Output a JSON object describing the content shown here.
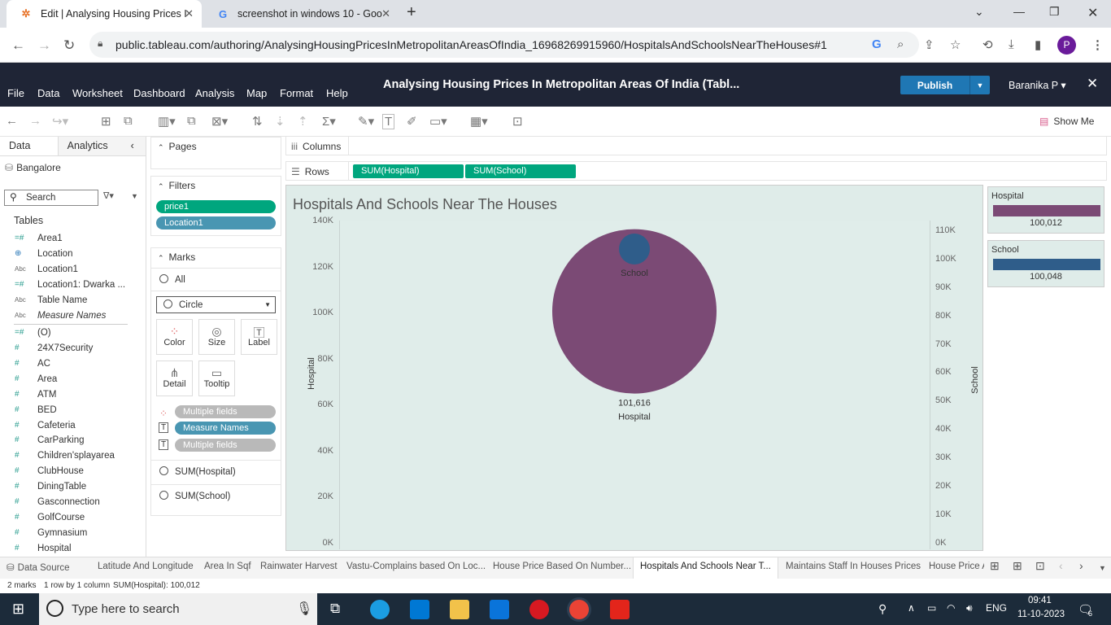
{
  "browser": {
    "tabs": [
      {
        "title": "Edit | Analysing Housing Prices I",
        "favicon": "tableau-icon",
        "active": true
      },
      {
        "title": "screenshot in windows 10 - Goo",
        "favicon": "google-icon",
        "active": false
      }
    ],
    "url": "public.tableau.com/authoring/AnalysingHousingPricesInMetropolitanAreasOfIndia_16968269915960/HospitalsAndSchoolsNearTheHouses#1",
    "profile_initial": "P"
  },
  "tableau": {
    "menu": [
      "File",
      "Data",
      "Worksheet",
      "Dashboard",
      "Analysis",
      "Map",
      "Format",
      "Help"
    ],
    "workbook_title": "Analysing Housing Prices In Metropolitan Areas Of India (Tabl...",
    "publish_label": "Publish",
    "user_name": "Baranika P ▾",
    "show_me": "Show Me"
  },
  "data_pane": {
    "tab_data": "Data",
    "tab_analytics": "Analytics",
    "datasource": "Bangalore",
    "search_placeholder": "Search",
    "tables_heading": "Tables",
    "fields": [
      {
        "name": "Area1",
        "type": "#="
      },
      {
        "name": "Location",
        "type": "globe"
      },
      {
        "name": "Location1",
        "type": "Abc"
      },
      {
        "name": "Location1: Dwarka ...",
        "type": "#="
      },
      {
        "name": "Table Name",
        "type": "Abc"
      },
      {
        "name": "Measure Names",
        "type": "Abc"
      },
      {
        "name": "(O)",
        "type": "#="
      },
      {
        "name": "24X7Security",
        "type": "#"
      },
      {
        "name": "AC",
        "type": "#"
      },
      {
        "name": "Area",
        "type": "#"
      },
      {
        "name": "ATM",
        "type": "#"
      },
      {
        "name": "BED",
        "type": "#"
      },
      {
        "name": "Cafeteria",
        "type": "#"
      },
      {
        "name": "CarParking",
        "type": "#"
      },
      {
        "name": "Children'splayarea",
        "type": "#"
      },
      {
        "name": "ClubHouse",
        "type": "#"
      },
      {
        "name": "DiningTable",
        "type": "#"
      },
      {
        "name": "Gasconnection",
        "type": "#"
      },
      {
        "name": "GolfCourse",
        "type": "#"
      },
      {
        "name": "Gymnasium",
        "type": "#"
      },
      {
        "name": "Hospital",
        "type": "#"
      }
    ]
  },
  "cards": {
    "pages_label": "Pages",
    "filters_label": "Filters",
    "filters": [
      "price1",
      "Location1"
    ],
    "marks_label": "Marks",
    "all_label": "All",
    "mark_type": "Circle",
    "mark_buttons": [
      "Color",
      "Size",
      "Label",
      "Detail",
      "Tooltip"
    ],
    "mark_pills": [
      "Multiple fields",
      "Measure Names",
      "Multiple fields"
    ],
    "sum_hospital": "SUM(Hospital)",
    "sum_school": "SUM(School)"
  },
  "shelves": {
    "columns_label": "Columns",
    "rows_label": "Rows",
    "rows_pills": [
      "SUM(Hospital)",
      "SUM(School)"
    ]
  },
  "view": {
    "title": "Hospitals And Schools Near The Houses"
  },
  "chart_data": {
    "type": "scatter",
    "title": "Hospitals And Schools Near The Houses",
    "ylabel_left": "Hospital",
    "ylabel_right": "School",
    "yticks_left": [
      "140K",
      "120K",
      "100K",
      "80K",
      "60K",
      "40K",
      "20K",
      "0K"
    ],
    "yticks_right": [
      "110K",
      "100K",
      "90K",
      "80K",
      "70K",
      "60K",
      "50K",
      "40K",
      "30K",
      "20K",
      "10K",
      "0K"
    ],
    "ylim_left": [
      0,
      140000
    ],
    "ylim_right": [
      0,
      110000
    ],
    "series": [
      {
        "name": "Hospital",
        "value": 101616,
        "label_value": "101,616",
        "label_name": "Hospital",
        "color": "#7b4a75"
      },
      {
        "name": "School",
        "value": 100048,
        "label_name": "School",
        "color": "#2f5d8a"
      }
    ]
  },
  "legends": [
    {
      "title": "Hospital",
      "value": "100,012",
      "color": "#7b4a75"
    },
    {
      "title": "School",
      "value": "100,048",
      "color": "#2f5d8a"
    }
  ],
  "sheet_tabs": {
    "data_source": "Data Source",
    "tabs": [
      "Latitude And Longitude",
      "Area In Sqf",
      "Rainwater Harvest",
      "Vastu-Complains based On Loc...",
      "House Price Based On Number...",
      "Hospitals And Schools Near T...",
      "Maintains Staff In Houses Prices",
      "House Price A"
    ]
  },
  "status": {
    "marks": "2 marks",
    "rows": "1 row by 1 column",
    "sum": "SUM(Hospital): 100,012"
  },
  "taskbar": {
    "search_placeholder": "Type here to search",
    "lang": "ENG",
    "time": "09:41",
    "date": "11-10-2023",
    "notif_count": "6"
  }
}
